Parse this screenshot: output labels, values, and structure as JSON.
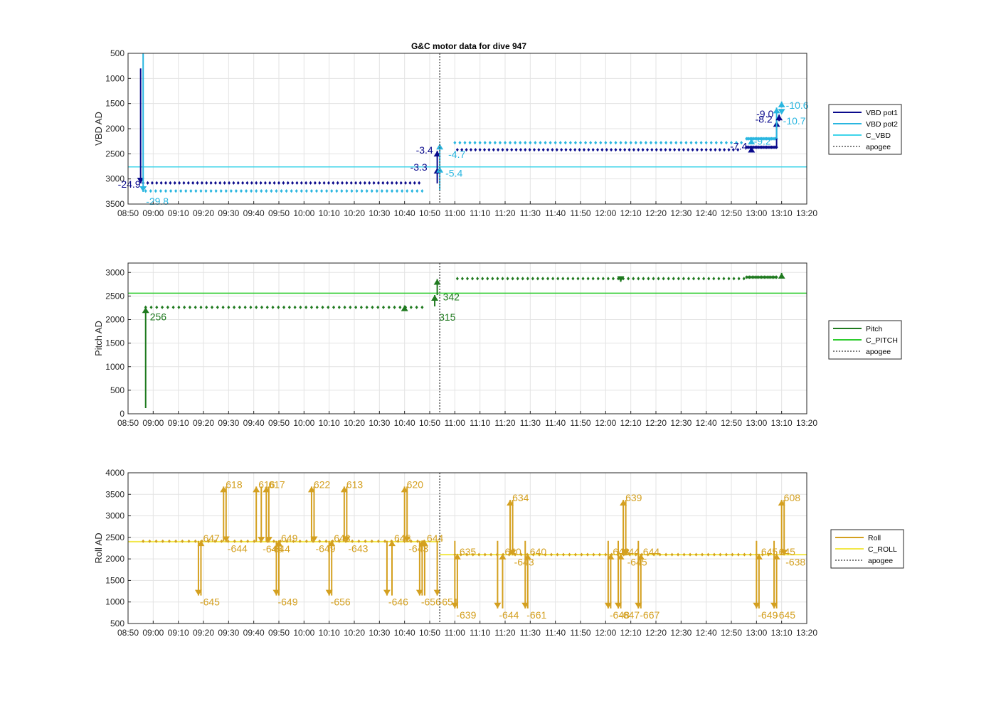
{
  "title": "G&C motor data for dive 947",
  "chart_data": [
    {
      "type": "line",
      "ylabel": "VBD AD",
      "ylim": [
        3500,
        500
      ],
      "y_reversed": true,
      "yticks": [
        500,
        1000,
        1500,
        2000,
        2500,
        3000,
        3500
      ],
      "xlim": [
        "08:50",
        "13:20"
      ],
      "xticks": [
        "08:50",
        "09:00",
        "09:10",
        "09:20",
        "09:30",
        "09:40",
        "09:50",
        "10:00",
        "10:10",
        "10:20",
        "10:30",
        "10:40",
        "10:50",
        "11:00",
        "11:10",
        "11:20",
        "11:30",
        "11:40",
        "11:50",
        "12:00",
        "12:10",
        "12:20",
        "12:30",
        "12:40",
        "12:50",
        "13:00",
        "13:10",
        "13:20"
      ],
      "grid": true,
      "legend_placement": "outside-right",
      "legend": [
        "VBD pot1",
        "VBD pot2",
        "C_VBD",
        "apogee"
      ],
      "series": [
        {
          "name": "VBD pot1",
          "color": "#0a0a8c",
          "dots": {
            "start": "08:56",
            "end": "10:47",
            "step_min": 1.8,
            "value": 3080
          },
          "dots2": {
            "start": "11:01",
            "end": "12:54",
            "step_min": 1.8,
            "value": 2420
          },
          "dots3": {
            "start": "12:56",
            "end": "13:08",
            "step_min": 0.5,
            "value": 2370
          }
        },
        {
          "name": "VBD pot2",
          "color": "#29b6e0",
          "dots": {
            "start": "08:57",
            "end": "10:47",
            "step_min": 2.0,
            "value": 3240
          },
          "dots2": {
            "start": "11:00",
            "end": "12:54",
            "step_min": 2.0,
            "value": 2280
          },
          "dots3": {
            "start": "12:56",
            "end": "13:08",
            "step_min": 0.5,
            "value": 2200
          }
        },
        {
          "name": "C_VBD",
          "color": "#3fd4ea",
          "constant": 2760
        }
      ],
      "moves": [
        {
          "t": "08:55",
          "from": 800,
          "to": 3090,
          "color": "#0a0a8c",
          "label": "-24.9",
          "label_dx": -32,
          "label_dy": 6
        },
        {
          "t": "08:56",
          "from": 500,
          "to": 3260,
          "color": "#29b6e0",
          "label": "-29.8",
          "label_dx": 4,
          "label_dy": 18
        },
        {
          "t": "10:53",
          "from": 3090,
          "to": 2780,
          "color": "#0a0a8c",
          "label": "-3.3",
          "label_dx": -38,
          "label_dy": 4
        },
        {
          "t": "10:53",
          "from": 2780,
          "to": 2440,
          "color": "#0a0a8c",
          "label": "-3.4",
          "label_dx": -30,
          "label_dy": 4
        },
        {
          "t": "10:54",
          "from": 3230,
          "to": 2760,
          "color": "#29b6e0",
          "label": "-5.4",
          "label_dx": 8,
          "label_dy": 14
        },
        {
          "t": "10:54",
          "from": 2760,
          "to": 2300,
          "color": "#29b6e0",
          "label": "-4.7",
          "label_dx": 12,
          "label_dy": 20
        },
        {
          "t": "12:58",
          "from": 2420,
          "to": 2360,
          "color": "#0a0a8c",
          "label": "-7.4",
          "label_dx": -30,
          "label_dy": 4
        },
        {
          "t": "12:58",
          "from": 2280,
          "to": 2200,
          "color": "#29b6e0",
          "label": "",
          "label_dx": 0,
          "label_dy": 0
        },
        {
          "t": "13:08",
          "from": 2360,
          "to": 1850,
          "color": "#0a0a8c",
          "label": "-8.2",
          "label_dx": -30,
          "label_dy": 2
        },
        {
          "t": "13:08",
          "from": 2200,
          "to": 1580,
          "color": "#29b6e0",
          "label": "-9.2",
          "label_dx": -32,
          "label_dy": 52
        },
        {
          "t": "13:09",
          "from": 1850,
          "to": 1720,
          "color": "#0a0a8c",
          "label": "-9.0",
          "label_dx": -32,
          "label_dy": 4
        },
        {
          "t": "13:10",
          "from": 1580,
          "to": 1460,
          "color": "#29b6e0",
          "label": "-10.6",
          "label_dx": 6,
          "label_dy": 10
        },
        {
          "t": "13:10",
          "from": 1720,
          "to": 1720,
          "color": "#29b6e0",
          "label": "-10.7",
          "label_dx": 2,
          "label_dy": 14
        }
      ],
      "apogee": "10:54"
    },
    {
      "type": "line",
      "ylabel": "Pitch AD",
      "ylim": [
        0,
        3200
      ],
      "yticks": [
        0,
        500,
        1000,
        1500,
        2000,
        2500,
        3000
      ],
      "xlim": [
        "08:50",
        "13:20"
      ],
      "xticks": [
        "08:50",
        "09:00",
        "09:10",
        "09:20",
        "09:30",
        "09:40",
        "09:50",
        "10:00",
        "10:10",
        "10:20",
        "10:30",
        "10:40",
        "10:50",
        "11:00",
        "11:10",
        "11:20",
        "11:30",
        "11:40",
        "11:50",
        "12:00",
        "12:10",
        "12:20",
        "12:30",
        "12:40",
        "12:50",
        "13:00",
        "13:10",
        "13:20"
      ],
      "grid": true,
      "legend_placement": "outside-right",
      "legend": [
        "Pitch",
        "C_PITCH",
        "apogee"
      ],
      "series": [
        {
          "name": "Pitch",
          "color": "#1f7a1f",
          "dots": {
            "start": "08:57",
            "end": "10:47",
            "step_min": 2.2,
            "value": 2260
          },
          "dots2": {
            "start": "11:01",
            "end": "12:56",
            "step_min": 2.0,
            "value": 2870
          },
          "dots3": {
            "start": "12:56",
            "end": "13:08",
            "step_min": 0.6,
            "value": 2900
          }
        },
        {
          "name": "C_PITCH",
          "color": "#2ecc2e",
          "constant": 2560
        }
      ],
      "moves": [
        {
          "t": "08:57",
          "from": 120,
          "to": 2260,
          "color": "#1f7a1f",
          "label": "256",
          "label_dx": 6,
          "label_dy": 18
        },
        {
          "t": "10:40",
          "from": 2260,
          "to": 2300,
          "color": "#1f7a1f",
          "label": "",
          "label_dx": 0,
          "label_dy": 0
        },
        {
          "t": "10:52",
          "from": 2280,
          "to": 2520,
          "color": "#1f7a1f",
          "label": "315",
          "label_dx": 6,
          "label_dy": 36
        },
        {
          "t": "10:53",
          "from": 2520,
          "to": 2860,
          "color": "#1f7a1f",
          "label": "342",
          "label_dx": 8,
          "label_dy": 30
        },
        {
          "t": "12:06",
          "from": 2870,
          "to": 2800,
          "color": "#1f7a1f",
          "label": "",
          "label_dx": 0,
          "label_dy": 0
        },
        {
          "t": "13:10",
          "from": 2900,
          "to": 2990,
          "color": "#1f7a1f",
          "label": "",
          "label_dx": 0,
          "label_dy": 0
        }
      ],
      "apogee": "10:54"
    },
    {
      "type": "line",
      "ylabel": "Roll AD",
      "ylim": [
        500,
        4000
      ],
      "yticks": [
        500,
        1000,
        1500,
        2000,
        2500,
        3000,
        3500,
        4000
      ],
      "xlim": [
        "08:50",
        "13:20"
      ],
      "xticks": [
        "08:50",
        "09:00",
        "09:10",
        "09:20",
        "09:30",
        "09:40",
        "09:50",
        "10:00",
        "10:10",
        "10:20",
        "10:30",
        "10:40",
        "10:50",
        "11:00",
        "11:10",
        "11:20",
        "11:30",
        "11:40",
        "11:50",
        "12:00",
        "12:10",
        "12:20",
        "12:30",
        "12:40",
        "12:50",
        "13:00",
        "13:10",
        "13:20"
      ],
      "grid": true,
      "legend_placement": "outside-right",
      "legend": [
        "Roll",
        "C_ROLL",
        "apogee"
      ],
      "series": [
        {
          "name": "Roll",
          "color": "#d4a020",
          "dots": {
            "start": "08:56",
            "end": "10:50",
            "step_min": 2.6,
            "value": 2410
          },
          "dots2": {
            "start": "11:00",
            "end": "13:07",
            "step_min": 2.4,
            "value": 2100
          }
        },
        {
          "name": "C_ROLL",
          "color": "#f2e84a",
          "constant_segments": [
            {
              "from": "08:50",
              "to": "10:54",
              "value": 2400
            },
            {
              "from": "10:54",
              "to": "13:20",
              "value": 2100
            }
          ]
        }
      ],
      "pairs": [
        {
          "t1": "09:18",
          "t2": "09:19",
          "down": 1150,
          "up": 2430,
          "down_label": "-645",
          "up_label": "647"
        },
        {
          "t1": "09:29",
          "t2": "09:28",
          "down": 2390,
          "up": 3680,
          "down_label": "-644",
          "up_label": "618"
        },
        {
          "t1": "09:43",
          "t2": "09:41",
          "down": 2380,
          "up": 3680,
          "down_label": "-646",
          "up_label": "616"
        },
        {
          "t1": "09:46",
          "t2": "09:45",
          "down": 2380,
          "up": 3680,
          "down_label": "-644",
          "up_label": "617"
        },
        {
          "t1": "09:49",
          "t2": "09:50",
          "down": 1150,
          "up": 2430,
          "down_label": "-649",
          "up_label": "649"
        },
        {
          "t1": "10:04",
          "t2": "10:03",
          "down": 2390,
          "up": 3680,
          "down_label": "-649",
          "up_label": "622"
        },
        {
          "t1": "10:17",
          "t2": "10:16",
          "down": 2390,
          "up": 3680,
          "down_label": "-643",
          "up_label": "613"
        },
        {
          "t1": "10:10",
          "t2": "10:11",
          "down": 1150,
          "up": 2430,
          "down_label": "-656",
          "up_label": "643"
        },
        {
          "t1": "10:33",
          "t2": "10:35",
          "down": 1150,
          "up": 2430,
          "down_label": "-646",
          "up_label": "645"
        },
        {
          "t1": "10:41",
          "t2": "10:40",
          "down": 2390,
          "up": 3680,
          "down_label": "-643",
          "up_label": "620"
        },
        {
          "t1": "10:46",
          "t2": "10:47",
          "down": 1150,
          "up": 2430,
          "down_label": "-656",
          "up_label": ""
        },
        {
          "t1": "10:53",
          "t2": "10:48",
          "down": 1150,
          "up": 2430,
          "down_label": "-651",
          "up_label": "644"
        },
        {
          "t1": "11:00",
          "t2": "11:01",
          "down": 850,
          "up": 2120,
          "down_label": "-639",
          "up_label": "635"
        },
        {
          "t1": "11:17",
          "t2": "11:19",
          "down": 850,
          "up": 2120,
          "down_label": "-644",
          "up_label": "640"
        },
        {
          "t1": "11:23",
          "t2": "11:22",
          "down": 2080,
          "up": 3370,
          "down_label": "-643",
          "up_label": "634"
        },
        {
          "t1": "11:28",
          "t2": "11:29",
          "down": 850,
          "up": 2120,
          "down_label": "-661",
          "up_label": "640"
        },
        {
          "t1": "12:01",
          "t2": "12:02",
          "down": 850,
          "up": 2120,
          "down_label": "-648",
          "up_label": "643"
        },
        {
          "t1": "12:08",
          "t2": "12:07",
          "down": 2080,
          "up": 3370,
          "down_label": "-645",
          "up_label": "639"
        },
        {
          "t1": "12:05",
          "t2": "12:06",
          "down": 850,
          "up": 2120,
          "down_label": "-647",
          "up_label": "644"
        },
        {
          "t1": "12:13",
          "t2": "12:14",
          "down": 850,
          "up": 2120,
          "down_label": "-667",
          "up_label": "644"
        },
        {
          "t1": "13:00",
          "t2": "13:01",
          "down": 850,
          "up": 2120,
          "down_label": "-649",
          "up_label": "645"
        },
        {
          "t1": "13:07",
          "t2": "13:08",
          "down": 850,
          "up": 2120,
          "down_label": "-645",
          "up_label": "645"
        },
        {
          "t1": "13:11",
          "t2": "13:10",
          "down": 2080,
          "up": 3370,
          "down_label": "-638",
          "up_label": "608"
        }
      ],
      "apogee": "10:54"
    }
  ]
}
